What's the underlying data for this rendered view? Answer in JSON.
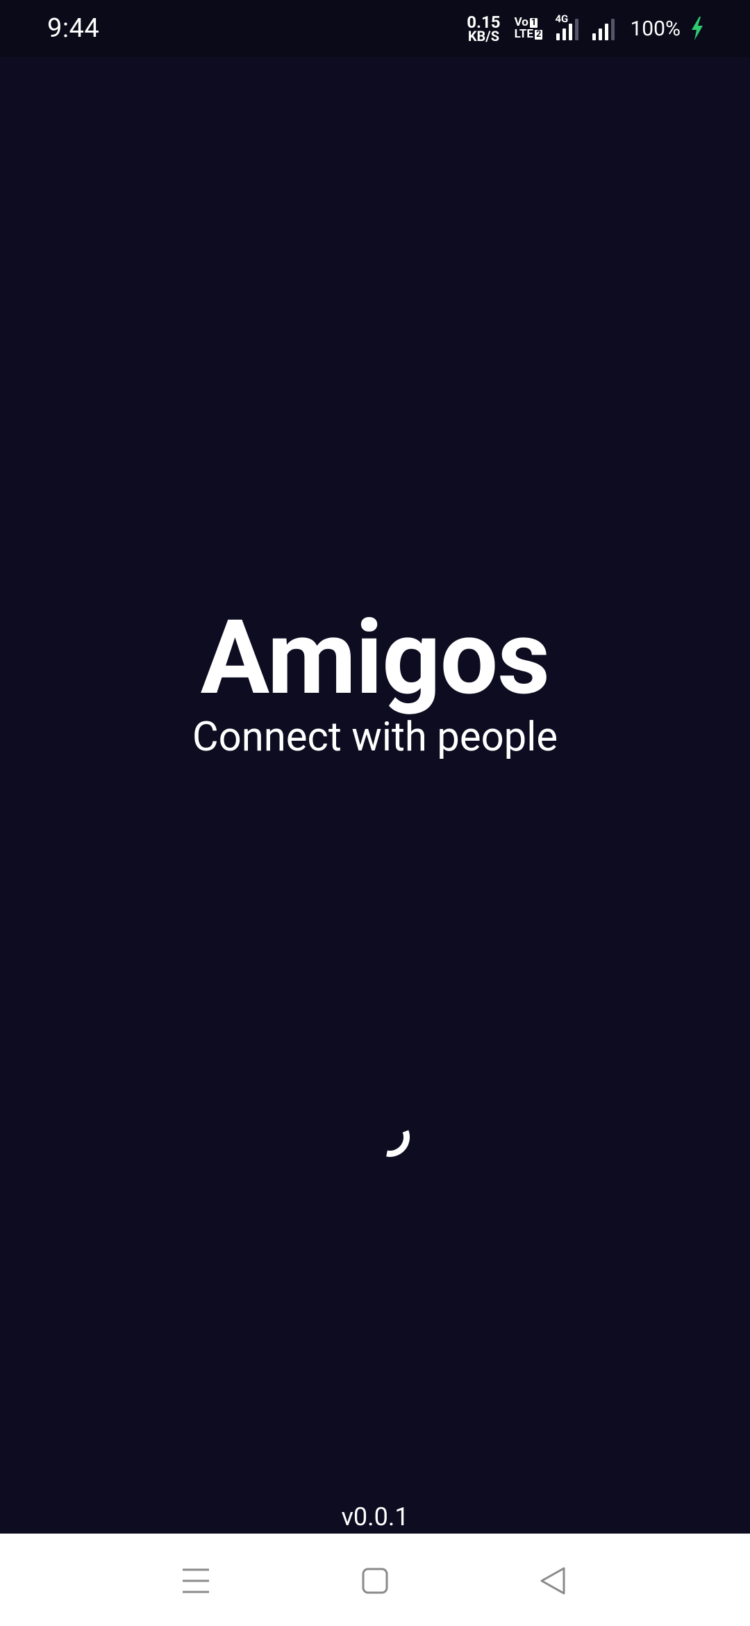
{
  "status_bar": {
    "time": "9:44",
    "net_speed_value": "0.15",
    "net_speed_unit": "KB/S",
    "volte_top": "Vo",
    "volte_top_badge": "1",
    "volte_bottom": "LTE",
    "volte_bottom_badge": "2",
    "network_type": "4G",
    "battery_percent": "100%",
    "charging_color": "#2ecc71"
  },
  "splash": {
    "title": "Amigos",
    "subtitle": "Connect with people",
    "version": "v0.0.1"
  },
  "nav_bar": {
    "menu_icon": "menu-lines-icon",
    "home_icon": "square-home-icon",
    "back_icon": "triangle-back-icon"
  },
  "colors": {
    "background": "#0d0c21",
    "status_bar_bg": "#0a0a18",
    "text": "#ffffff",
    "nav_bar_bg": "#ffffff",
    "nav_icon": "#8a8a8a"
  }
}
